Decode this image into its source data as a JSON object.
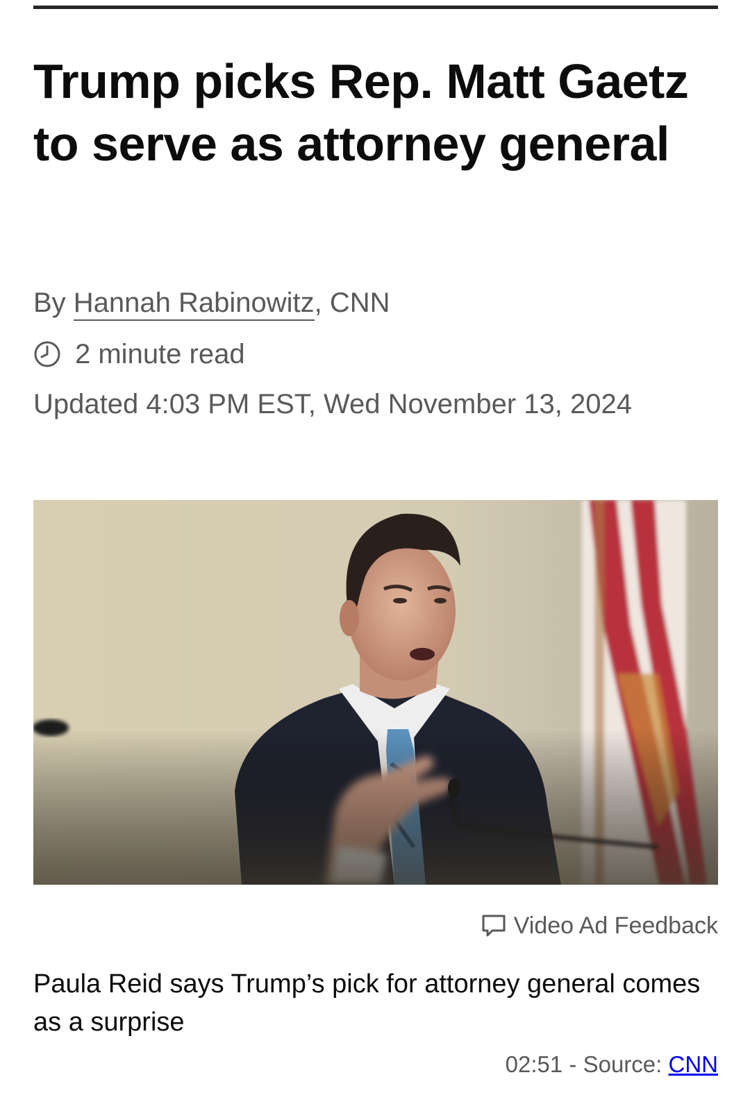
{
  "article": {
    "headline": "Trump picks Rep. Matt Gaetz to serve as attorney general",
    "byline_prefix": "By ",
    "author": "Hannah Rabinowitz",
    "byline_suffix": ", CNN",
    "read_time": "2 minute read",
    "updated": "Updated 4:03 PM EST, Wed November 13, 2024"
  },
  "video": {
    "ad_feedback_label": "Video Ad Feedback",
    "caption": "Paula Reid says Trump’s pick for attorney general comes as a surprise",
    "duration": "02:51",
    "source_prefix": " - Source: ",
    "source_name": "CNN"
  },
  "icons": {
    "clock": "clock-icon",
    "feedback": "feedback-icon"
  },
  "colors": {
    "text": "#0c0c0c",
    "meta_text": "#595959",
    "rule": "#262626",
    "link": "#0000ee"
  }
}
